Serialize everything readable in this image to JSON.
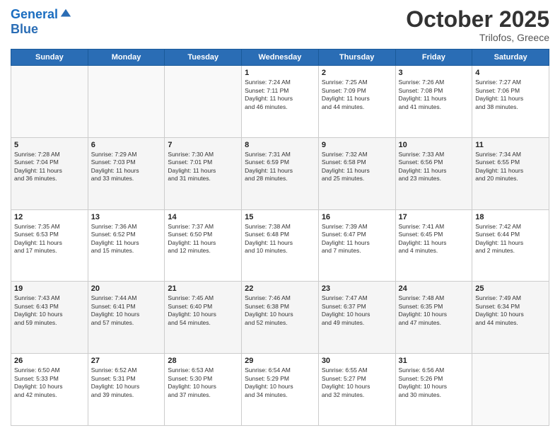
{
  "header": {
    "logo_line1": "General",
    "logo_line2": "Blue",
    "month": "October 2025",
    "location": "Trilofos, Greece"
  },
  "days_of_week": [
    "Sunday",
    "Monday",
    "Tuesday",
    "Wednesday",
    "Thursday",
    "Friday",
    "Saturday"
  ],
  "weeks": [
    [
      {
        "day": "",
        "info": ""
      },
      {
        "day": "",
        "info": ""
      },
      {
        "day": "",
        "info": ""
      },
      {
        "day": "1",
        "info": "Sunrise: 7:24 AM\nSunset: 7:11 PM\nDaylight: 11 hours\nand 46 minutes."
      },
      {
        "day": "2",
        "info": "Sunrise: 7:25 AM\nSunset: 7:09 PM\nDaylight: 11 hours\nand 44 minutes."
      },
      {
        "day": "3",
        "info": "Sunrise: 7:26 AM\nSunset: 7:08 PM\nDaylight: 11 hours\nand 41 minutes."
      },
      {
        "day": "4",
        "info": "Sunrise: 7:27 AM\nSunset: 7:06 PM\nDaylight: 11 hours\nand 38 minutes."
      }
    ],
    [
      {
        "day": "5",
        "info": "Sunrise: 7:28 AM\nSunset: 7:04 PM\nDaylight: 11 hours\nand 36 minutes."
      },
      {
        "day": "6",
        "info": "Sunrise: 7:29 AM\nSunset: 7:03 PM\nDaylight: 11 hours\nand 33 minutes."
      },
      {
        "day": "7",
        "info": "Sunrise: 7:30 AM\nSunset: 7:01 PM\nDaylight: 11 hours\nand 31 minutes."
      },
      {
        "day": "8",
        "info": "Sunrise: 7:31 AM\nSunset: 6:59 PM\nDaylight: 11 hours\nand 28 minutes."
      },
      {
        "day": "9",
        "info": "Sunrise: 7:32 AM\nSunset: 6:58 PM\nDaylight: 11 hours\nand 25 minutes."
      },
      {
        "day": "10",
        "info": "Sunrise: 7:33 AM\nSunset: 6:56 PM\nDaylight: 11 hours\nand 23 minutes."
      },
      {
        "day": "11",
        "info": "Sunrise: 7:34 AM\nSunset: 6:55 PM\nDaylight: 11 hours\nand 20 minutes."
      }
    ],
    [
      {
        "day": "12",
        "info": "Sunrise: 7:35 AM\nSunset: 6:53 PM\nDaylight: 11 hours\nand 17 minutes."
      },
      {
        "day": "13",
        "info": "Sunrise: 7:36 AM\nSunset: 6:52 PM\nDaylight: 11 hours\nand 15 minutes."
      },
      {
        "day": "14",
        "info": "Sunrise: 7:37 AM\nSunset: 6:50 PM\nDaylight: 11 hours\nand 12 minutes."
      },
      {
        "day": "15",
        "info": "Sunrise: 7:38 AM\nSunset: 6:48 PM\nDaylight: 11 hours\nand 10 minutes."
      },
      {
        "day": "16",
        "info": "Sunrise: 7:39 AM\nSunset: 6:47 PM\nDaylight: 11 hours\nand 7 minutes."
      },
      {
        "day": "17",
        "info": "Sunrise: 7:41 AM\nSunset: 6:45 PM\nDaylight: 11 hours\nand 4 minutes."
      },
      {
        "day": "18",
        "info": "Sunrise: 7:42 AM\nSunset: 6:44 PM\nDaylight: 11 hours\nand 2 minutes."
      }
    ],
    [
      {
        "day": "19",
        "info": "Sunrise: 7:43 AM\nSunset: 6:43 PM\nDaylight: 10 hours\nand 59 minutes."
      },
      {
        "day": "20",
        "info": "Sunrise: 7:44 AM\nSunset: 6:41 PM\nDaylight: 10 hours\nand 57 minutes."
      },
      {
        "day": "21",
        "info": "Sunrise: 7:45 AM\nSunset: 6:40 PM\nDaylight: 10 hours\nand 54 minutes."
      },
      {
        "day": "22",
        "info": "Sunrise: 7:46 AM\nSunset: 6:38 PM\nDaylight: 10 hours\nand 52 minutes."
      },
      {
        "day": "23",
        "info": "Sunrise: 7:47 AM\nSunset: 6:37 PM\nDaylight: 10 hours\nand 49 minutes."
      },
      {
        "day": "24",
        "info": "Sunrise: 7:48 AM\nSunset: 6:35 PM\nDaylight: 10 hours\nand 47 minutes."
      },
      {
        "day": "25",
        "info": "Sunrise: 7:49 AM\nSunset: 6:34 PM\nDaylight: 10 hours\nand 44 minutes."
      }
    ],
    [
      {
        "day": "26",
        "info": "Sunrise: 6:50 AM\nSunset: 5:33 PM\nDaylight: 10 hours\nand 42 minutes."
      },
      {
        "day": "27",
        "info": "Sunrise: 6:52 AM\nSunset: 5:31 PM\nDaylight: 10 hours\nand 39 minutes."
      },
      {
        "day": "28",
        "info": "Sunrise: 6:53 AM\nSunset: 5:30 PM\nDaylight: 10 hours\nand 37 minutes."
      },
      {
        "day": "29",
        "info": "Sunrise: 6:54 AM\nSunset: 5:29 PM\nDaylight: 10 hours\nand 34 minutes."
      },
      {
        "day": "30",
        "info": "Sunrise: 6:55 AM\nSunset: 5:27 PM\nDaylight: 10 hours\nand 32 minutes."
      },
      {
        "day": "31",
        "info": "Sunrise: 6:56 AM\nSunset: 5:26 PM\nDaylight: 10 hours\nand 30 minutes."
      },
      {
        "day": "",
        "info": ""
      }
    ]
  ]
}
